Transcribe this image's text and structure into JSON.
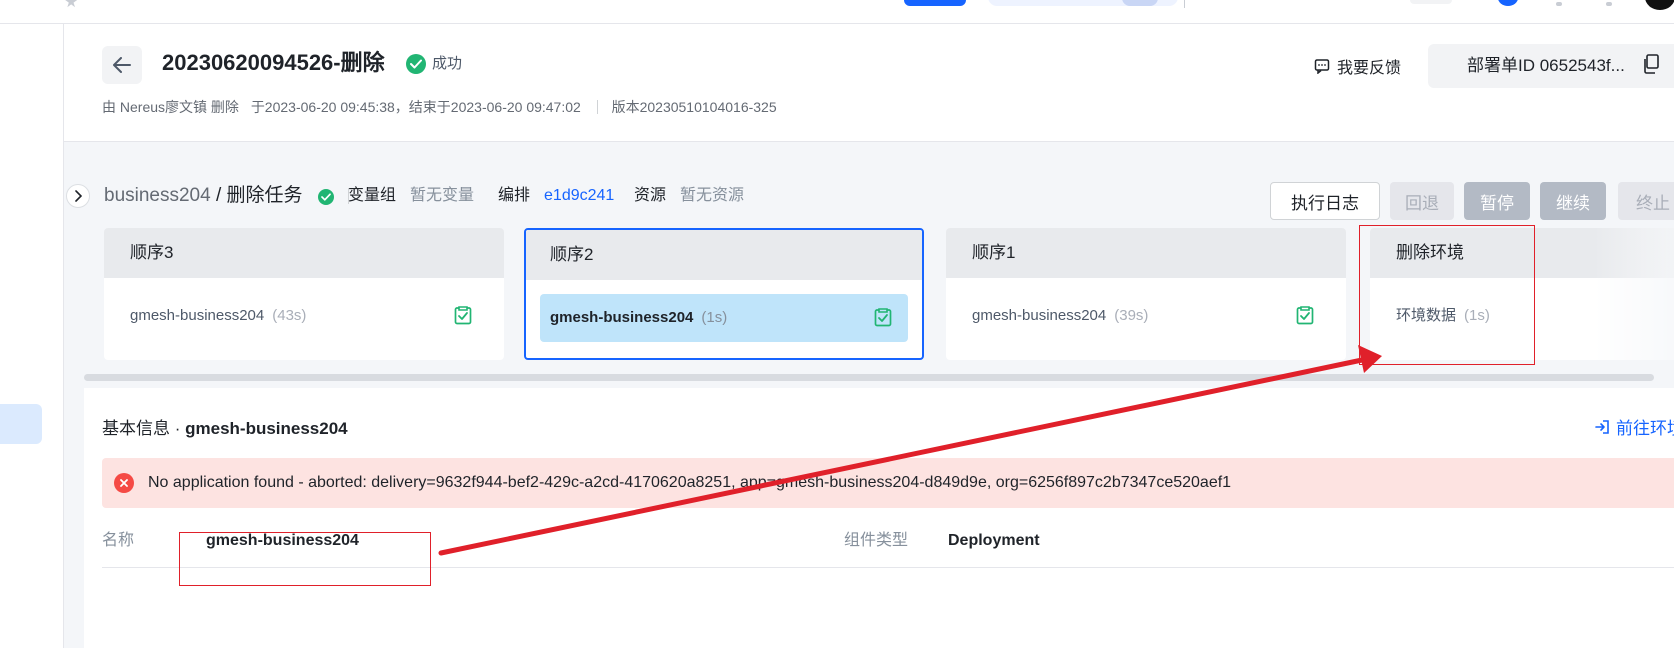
{
  "header": {
    "title": "20230620094526-删除",
    "status": "成功",
    "meta_by": "由 Nereus廖文镇 删除",
    "meta_time": "于2023-06-20 09:45:38，结束于2023-06-20 09:47:02",
    "meta_version": "版本20230510104016-325",
    "feedback_label": "我要反馈",
    "deploy_id": "部署单ID 0652543f..."
  },
  "task": {
    "app": "business204",
    "separator": " / ",
    "name": "删除任务",
    "var_group_label": "变量组",
    "var_group_value": "暂无变量",
    "orchestration_label": "编排",
    "orchestration_value": "e1d9c241",
    "resource_label": "资源",
    "resource_value": "暂无资源",
    "buttons": {
      "log": "执行日志",
      "rollback": "回退",
      "pause": "暂停",
      "resume": "继续",
      "stop": "终止"
    }
  },
  "stages": [
    {
      "title": "顺序3",
      "item": "gmesh-business204",
      "duration": "(43s)"
    },
    {
      "title": "顺序2",
      "item": "gmesh-business204",
      "duration": "(1s)"
    },
    {
      "title": "顺序1",
      "item": "gmesh-business204",
      "duration": "(39s)"
    },
    {
      "title": "删除环境",
      "item": "环境数据",
      "duration": "(1s)"
    }
  ],
  "panel": {
    "title_prefix": "基本信息 · ",
    "title_name": "gmesh-business204",
    "goto_label": "前往环境",
    "error": "No application found - aborted: delivery=9632f944-bef2-429c-a2cd-4170620a8251, app=gmesh-business204-d849d9e, org=6256f897c2b7347ce520aef1",
    "name_label": "名称",
    "name_value": "gmesh-business204",
    "type_label": "组件类型",
    "type_value": "Deployment"
  },
  "colors": {
    "accent": "#1664ff",
    "success": "#21b573",
    "error": "#f54a45",
    "annotation": "#e0202a"
  }
}
